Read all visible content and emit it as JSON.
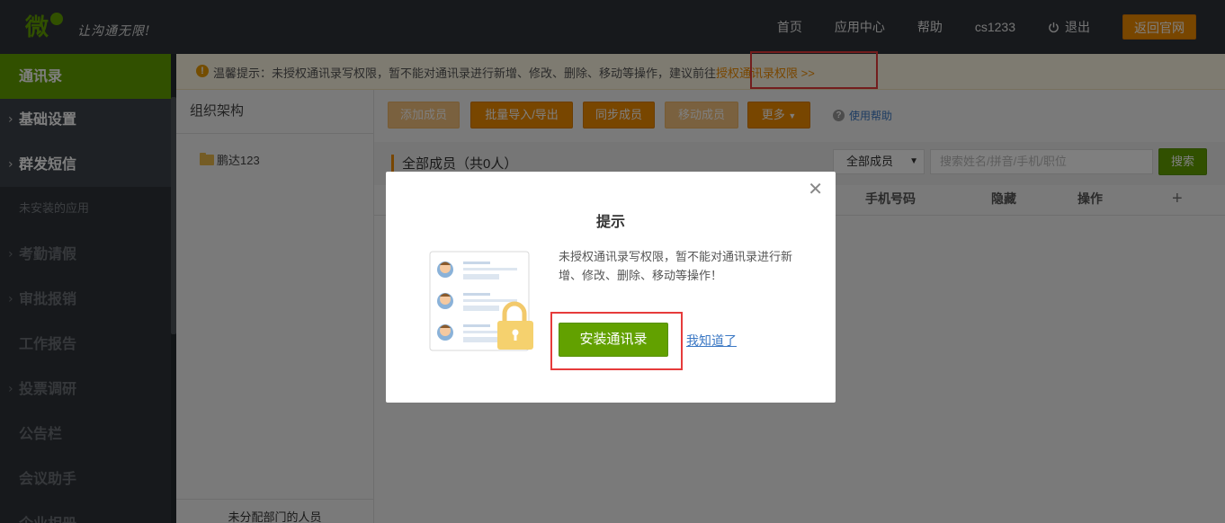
{
  "header": {
    "slogan": "让沟通无限!",
    "nav": [
      "首页",
      "应用中心",
      "帮助",
      "cs1233"
    ],
    "logout": "退出",
    "back_site": "返回官网"
  },
  "sidebar": {
    "items": [
      {
        "label": "通讯录",
        "active": true
      },
      {
        "label": "基础设置"
      },
      {
        "label": "群发短信"
      },
      {
        "label": "未安装的应用"
      },
      {
        "label": "考勤请假"
      },
      {
        "label": "审批报销"
      },
      {
        "label": "工作报告"
      },
      {
        "label": "投票调研"
      },
      {
        "label": "公告栏"
      },
      {
        "label": "会议助手"
      },
      {
        "label": "企业相册"
      }
    ]
  },
  "notice": {
    "prefix": "温馨提示：未授权通讯录写权限，暂不能对通讯录进行新增、修改、删除、移动等操作，建议前往",
    "link": "授权通讯录权限 >>"
  },
  "org": {
    "title": "组织架构",
    "node": "鹏达123",
    "footer": "未分配部门的人员"
  },
  "toolbar": {
    "add": "添加成员",
    "batch": "批量导入/导出",
    "sync": "同步成员",
    "move": "移动成员",
    "more": "更多",
    "help": "使用帮助"
  },
  "list": {
    "title": "全部成员（共0人）",
    "filter": "全部成员",
    "search_placeholder": "搜索姓名/拼音/手机/职位",
    "search_btn": "搜索",
    "columns": {
      "phone": "手机号码",
      "hidden": "隐藏",
      "ops": "操作",
      "add": "+"
    }
  },
  "modal": {
    "title": "提示",
    "message": "未授权通讯录写权限，暂不能对通讯录进行新增、修改、删除、移动等操作！",
    "install_btn": "安装通讯录",
    "dismiss": "我知道了"
  },
  "colors": {
    "accent_green": "#62a100",
    "accent_orange": "#f18d00",
    "header_bg": "#2e3339",
    "highlight_red": "#e63b3b"
  }
}
